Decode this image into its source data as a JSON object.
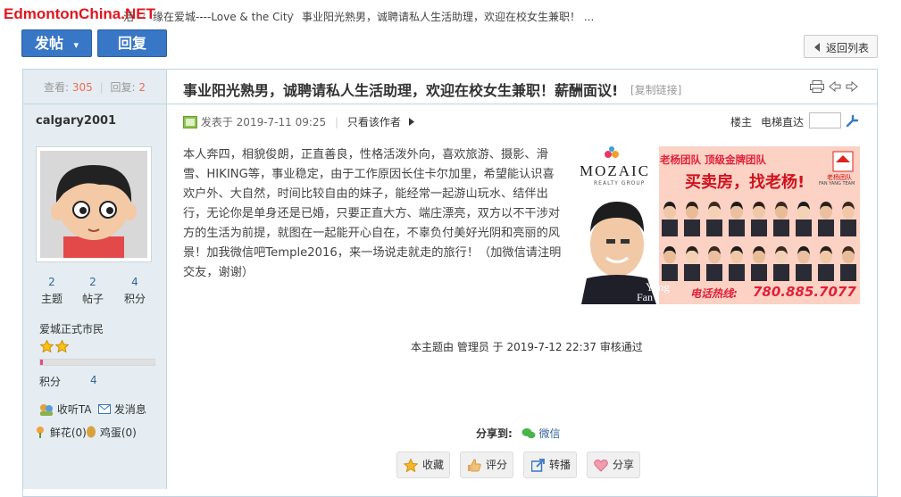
{
  "site": {
    "logo": "EdmontonChina.NET",
    "logo_color": "#e1161e"
  },
  "breadcrumb": {
    "home_tail": "活",
    "forum": "缘在爱城----Love & the City",
    "thread": "事业阳光熟男，诚聘请私人生活助理，欢迎在校女生兼职！ ...",
    "sep": "›"
  },
  "toolbar": {
    "new_post": "发帖",
    "dropdown_icon": "▾",
    "reply": "回复",
    "back_to_list": "返回列表"
  },
  "stats": {
    "views_label": "查看:",
    "views": "305",
    "replies_label": "回复:",
    "replies": "2"
  },
  "author": {
    "name": "calgary2001",
    "counts": [
      {
        "value": "2",
        "label": "主题"
      },
      {
        "value": "2",
        "label": "帖子"
      },
      {
        "value": "4",
        "label": "积分"
      }
    ],
    "rank": "爱城正式市民",
    "stars": 2,
    "progress": 0.02,
    "points_label": "积分",
    "points_value": "4",
    "follow_label": "收听TA",
    "message_label": "发消息",
    "flowers_label": "鲜花(0)",
    "eggs_label": "鸡蛋(0)"
  },
  "post": {
    "title": "事业阳光熟男，诚聘请私人生活助理，欢迎在校女生兼职！薪酬面议!",
    "copy_link": "[复制链接]",
    "posted_label": "发表于",
    "posted_time": "2019-7-11 09:25",
    "author_only": "只看该作者",
    "floor": "楼主",
    "jump_label": "电梯直达",
    "body": "本人奔四，相貌俊朗，正直善良，性格活泼外向，喜欢旅游、摄影、滑雪、HIKING等，事业稳定，由于工作原因长住卡尔加里，希望能认识喜欢户外、大自然，时间比较自由的妹子，能经常一起游山玩水、结伴出行，无论你是单身还是已婚，只要正直大方、端庄漂亮，双方以不干涉对方的生活为前提，就图在一起能开心自在，不辜负付美好光阴和亮丽的风景！加我微信吧Temple2016，来一场说走就走的旅行！（加微信请注明交友，谢谢）",
    "review_note": "本主题由 管理员 于 2019-7-12 22:37 审核通过",
    "share_label": "分享到:",
    "share_wechat": "微信"
  },
  "ad": {
    "brand": "MOZAIC",
    "brand_sub": "REALTY GROUP",
    "team_line": "老杨团队  顶级金牌团队",
    "headline": "买卖房，找老杨!",
    "badge": "老杨团队",
    "badge_sub": "FAN YANG TEAM",
    "agent_name": "Yang",
    "agent_name2": "Fan",
    "phone_label": "电话热线:",
    "phone": "780.885.7077"
  },
  "actions": [
    {
      "label": "收藏",
      "icon": "star-icon"
    },
    {
      "label": "评分",
      "icon": "thumb-icon"
    },
    {
      "label": "转播",
      "icon": "share-arrow-icon"
    },
    {
      "label": "分享",
      "icon": "heart-icon"
    }
  ],
  "colors": {
    "accent_blue": "#3877c6",
    "border": "#c2d5e3",
    "side_bg": "#e5edf2",
    "count_orange": "#f26c4f"
  }
}
